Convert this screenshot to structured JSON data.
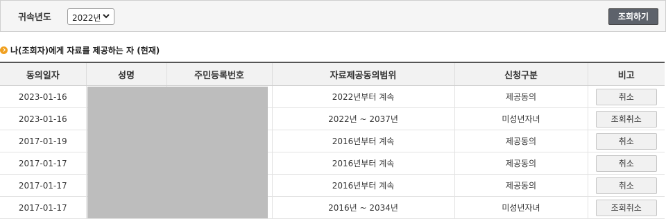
{
  "filter": {
    "year_label": "귀속년도",
    "year_value": "2022년",
    "search_label": "조회하기"
  },
  "section": {
    "title": "나(조회자)에게 자료를 제공하는 자 (현재)"
  },
  "table": {
    "headers": [
      "동의일자",
      "성명",
      "주민등록번호",
      "자료제공동의범위",
      "신청구분",
      "비고"
    ],
    "rows": [
      {
        "date": "2023-01-16",
        "scope": "2022년부터 계속",
        "type": "제공동의",
        "action": "취소"
      },
      {
        "date": "2023-01-16",
        "scope": "2022년 ~ 2037년",
        "type": "미성년자녀",
        "action": "조회취소"
      },
      {
        "date": "2017-01-19",
        "scope": "2016년부터 계속",
        "type": "제공동의",
        "action": "취소"
      },
      {
        "date": "2017-01-17",
        "scope": "2016년부터 계속",
        "type": "제공동의",
        "action": "취소"
      },
      {
        "date": "2017-01-17",
        "scope": "2016년부터 계속",
        "type": "제공동의",
        "action": "취소"
      },
      {
        "date": "2017-01-17",
        "scope": "2016년 ~ 2034년",
        "type": "미성년자녀",
        "action": "조회취소"
      }
    ]
  }
}
